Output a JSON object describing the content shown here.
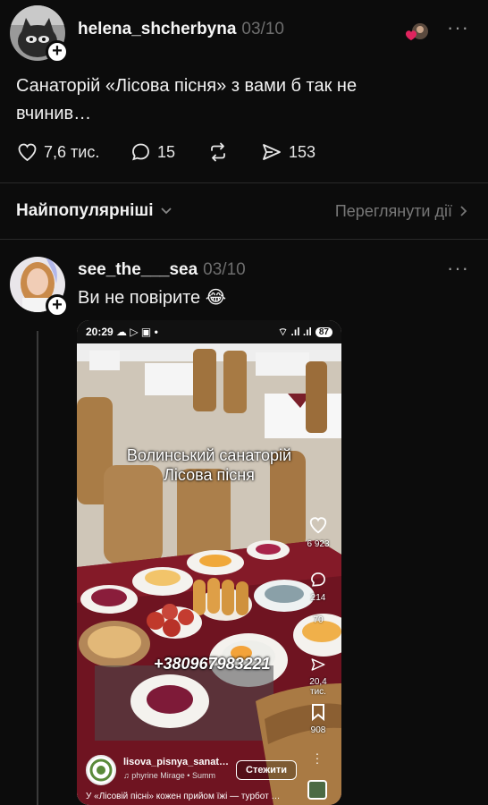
{
  "post": {
    "username": "helena_shcherbyna",
    "date": "03/10",
    "text_line1": "Санаторій «Лісова пісня» з вами б так не",
    "text_line2": "вчинив…",
    "likes": "7,6 тис.",
    "comments": "15",
    "shares": "153"
  },
  "sort": {
    "label": "Найпопулярніші",
    "view_activity": "Переглянути дії"
  },
  "reply": {
    "username": "see_the___sea",
    "date": "03/10",
    "text": "Ви не повірите 😂"
  },
  "embed": {
    "status_time": "20:29",
    "battery": "87",
    "overlay_line1": "Волинський санаторій",
    "overlay_line2": "Лісова пісня",
    "phone_number": "+380967983221",
    "likes": "6 923",
    "comments": "214",
    "saves_mid": "70",
    "shares": "20,4 тис.",
    "bookmarks": "908",
    "account": "lisova_pisnya_sanat…",
    "music": "phyrine Mirage • Summ",
    "follow": "Стежити",
    "caption": "У «Лісовій пісні» кожен прийом їжі — турбот …"
  },
  "colors": {
    "background": "#0c0c0c",
    "like_red": "#e0245e",
    "muted": "#6e6e6e"
  }
}
